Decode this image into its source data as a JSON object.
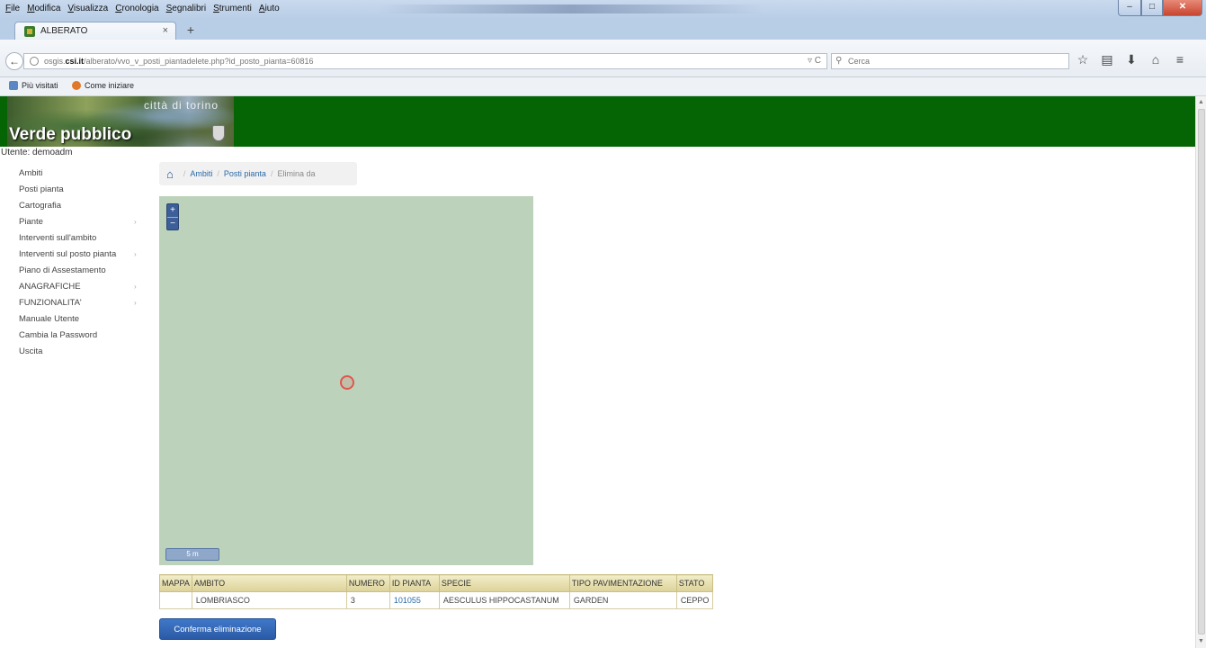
{
  "browser": {
    "menu": [
      "File",
      "Modifica",
      "Visualizza",
      "Cronologia",
      "Segnalibri",
      "Strumenti",
      "Aiuto"
    ],
    "tab_title": "ALBERATO",
    "tab_close": "×",
    "new_tab": "+",
    "url_prefix": "osgis.",
    "url_domain": "csi.it",
    "url_path": "/alberato/vvo_v_posti_piantadelete.php?id_posto_pianta=60816",
    "search_placeholder": "Cerca",
    "bookmarks": [
      "Più visitati",
      "Come iniziare"
    ]
  },
  "banner": {
    "city": "città di torino",
    "title": "Verde pubblico"
  },
  "user_label": "Utente: demoadm",
  "sidebar": {
    "items": [
      {
        "label": "Ambiti"
      },
      {
        "label": "Posti pianta"
      },
      {
        "label": "Cartografia"
      },
      {
        "label": "Piante",
        "arrow": "›"
      },
      {
        "label": "Interventi sull'ambito"
      },
      {
        "label": "Interventi sul posto pianta",
        "arrow": "›"
      },
      {
        "label": "Piano di Assestamento"
      },
      {
        "label": "ANAGRAFICHE",
        "arrow": "›"
      },
      {
        "label": "FUNZIONALITA'",
        "arrow": "›"
      },
      {
        "label": "Manuale Utente"
      },
      {
        "label": "Cambia la Password"
      },
      {
        "label": "Uscita"
      }
    ]
  },
  "breadcrumb": {
    "items": [
      "Ambiti",
      "Posti pianta"
    ],
    "current": "Elimina da"
  },
  "map": {
    "zoom_in": "+",
    "zoom_out": "−",
    "scale": "5 m"
  },
  "table": {
    "headers": [
      "MAPPA",
      "AMBITO",
      "NUMERO",
      "ID PIANTA",
      "SPECIE",
      "TIPO PAVIMENTAZIONE",
      "STATO"
    ],
    "row": {
      "mappa": "",
      "ambito": "LOMBRIASCO",
      "numero": "3",
      "id_pianta": "101055",
      "specie": "AESCULUS HIPPOCASTANUM",
      "tipo_pavimentazione": "GARDEN",
      "stato": "CEPPO"
    }
  },
  "confirm_button": "Conferma eliminazione",
  "colors": {
    "banner": "#056505",
    "map": "#bdd2ba",
    "button": "#2b5aa6",
    "marker": "#e0564e"
  }
}
